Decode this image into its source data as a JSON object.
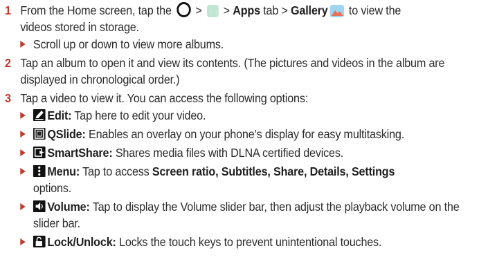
{
  "steps": [
    {
      "number": "1",
      "lines": {
        "before_circle": "From the Home screen, tap the",
        "sep1": " > ",
        "sep2": " > ",
        "apps": "Apps",
        "tab": " tab > ",
        "gallery": "Gallery",
        "after_gallery": " to view the",
        "cont": "videos stored in storage."
      },
      "subs": [
        "Scroll up or down to view more albums."
      ]
    },
    {
      "number": "2",
      "text": "Tap an album to open it and view its contents. (The pictures and videos in the album are displayed in chronological order.)"
    },
    {
      "number": "3",
      "text": "Tap a video to view it. You can access the following options:",
      "options": [
        {
          "icon": "edit-icon",
          "label": "Edit:",
          "desc": " Tap here to edit your video."
        },
        {
          "icon": "qslide-icon",
          "label": "QSlide:",
          "desc": " Enables an overlay on your phone’s display for easy multitasking."
        },
        {
          "icon": "smartshare-icon",
          "label": "SmartShare:",
          "desc": " Shares media files with DLNA certified devices."
        },
        {
          "icon": "menu-icon",
          "label": "Menu:",
          "desc": " Tap to access ",
          "bold_items": "Screen ratio, Subtitles, Share, Details, Settings",
          "tail": "options."
        },
        {
          "icon": "volume-icon",
          "label": "Volume:",
          "desc": " Tap to display the Volume slider bar, then adjust the playback volume on the slider bar."
        },
        {
          "icon": "lock-icon",
          "label": "Lock/Unlock:",
          "desc": " Locks the touch keys to prevent unintentional touches."
        }
      ]
    }
  ]
}
